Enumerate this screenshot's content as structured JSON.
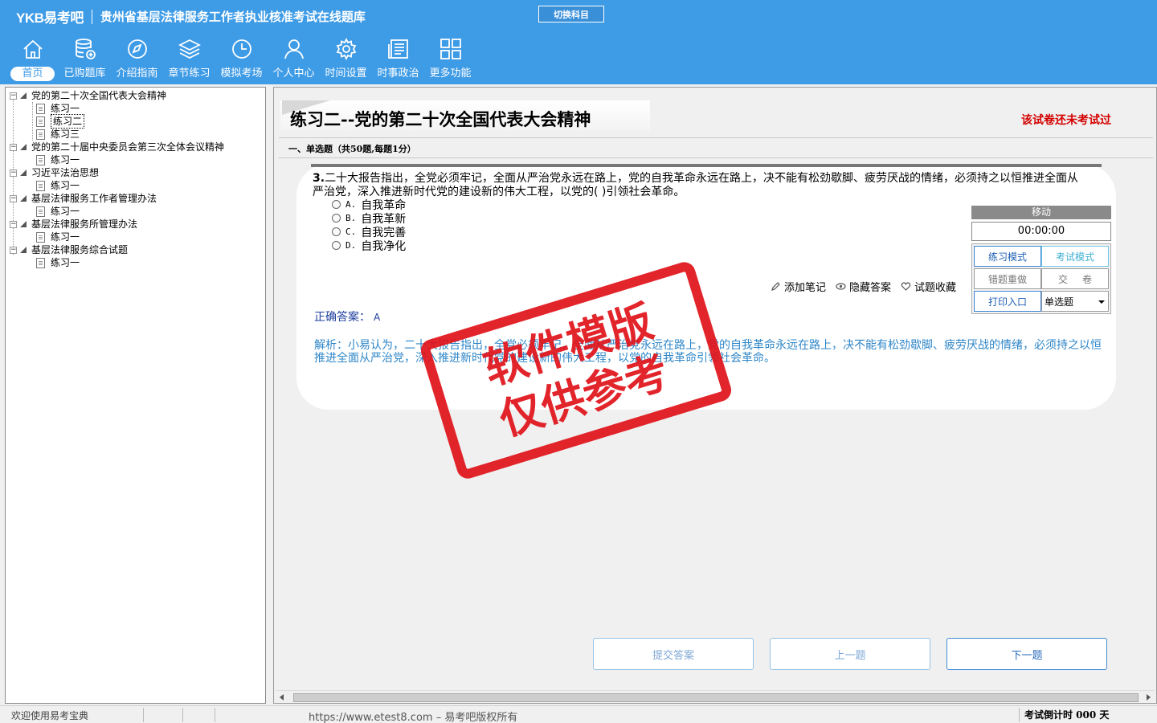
{
  "header": {
    "logo": "YKB易考吧",
    "app_title": "贵州省基层法律服务工作者执业核准考试在线题库",
    "switch_subject": "切换科目",
    "nav": [
      {
        "label": "首页",
        "icon": "home-icon",
        "active": true
      },
      {
        "label": "已购题库",
        "icon": "database-icon"
      },
      {
        "label": "介绍指南",
        "icon": "compass-icon"
      },
      {
        "label": "章节练习",
        "icon": "layers-icon"
      },
      {
        "label": "模拟考场",
        "icon": "clock-icon"
      },
      {
        "label": "个人中心",
        "icon": "user-icon"
      },
      {
        "label": "时间设置",
        "icon": "gear-icon"
      },
      {
        "label": "时事政治",
        "icon": "newspaper-icon"
      },
      {
        "label": "更多功能",
        "icon": "grid-icon"
      }
    ]
  },
  "tree": {
    "nodes": [
      {
        "label": "党的第二十次全国代表大会精神",
        "children": [
          "练习一",
          "练习二",
          "练习三"
        ]
      },
      {
        "label": "党的第二十届中央委员会第三次全体会议精神",
        "children": [
          "练习一"
        ]
      },
      {
        "label": "习近平法治思想",
        "children": [
          "练习一"
        ]
      },
      {
        "label": "基层法律服务工作者管理办法",
        "children": [
          "练习一"
        ]
      },
      {
        "label": "基层法律服务所管理办法",
        "children": [
          "练习一"
        ]
      },
      {
        "label": "基层法律服务综合试题",
        "children": [
          "练习一"
        ]
      }
    ],
    "selected": "练习二"
  },
  "main": {
    "paper_title": "练习二--党的第二十次全国代表大会精神",
    "status": "该试卷还未考试过",
    "section_title": "一、单选题（共50题,每题1分）",
    "question": {
      "number": "3.",
      "text": "二十大报告指出，全党必须牢记，全面从严治党永远在路上，党的自我革命永远在路上，决不能有松劲歇脚、疲劳厌战的情绪，必须持之以恒推进全面从严治党，深入推进新时代党的建设新的伟大工程，以党的( )引领社会革命。",
      "options": [
        {
          "key": "A.",
          "text": "自我革命"
        },
        {
          "key": "B.",
          "text": "自我革新"
        },
        {
          "key": "C.",
          "text": "自我完善"
        },
        {
          "key": "D.",
          "text": "自我净化"
        }
      ]
    },
    "tools": {
      "add_note": "添加笔记",
      "hide_answer": "隐藏答案",
      "favorite": "试题收藏"
    },
    "answer_label": "正确答案：",
    "answer_value": "A",
    "analysis": "解析：小易认为，二十大报告指出，全党必须牢记，全面从严治党永远在路上，党的自我革命永远在路上，决不能有松劲歇脚、疲劳厌战的情绪，必须持之以恒推进全面从严治党，深入推进新时代党的建设新的伟大工程，以党的自我革命引领社会革命。",
    "panel": {
      "move": "移动",
      "timer": "00:00:00",
      "practice_mode": "练习模式",
      "exam_mode": "考试模式",
      "redo_wrong": "错题重做",
      "submit_paper": "交卷",
      "print_entry": "打印入口",
      "question_type": "单选题"
    },
    "stamp": {
      "line1": "软件模版",
      "line2": "仅供参考"
    },
    "buttons": {
      "submit": "提交答案",
      "prev": "上一题",
      "next": "下一题"
    }
  },
  "statusbar": {
    "welcome": "欢迎使用易考宝典",
    "copyright": "https://www.etest8.com – 易考吧版权所有",
    "countdown": "考试倒计时 000 天"
  }
}
